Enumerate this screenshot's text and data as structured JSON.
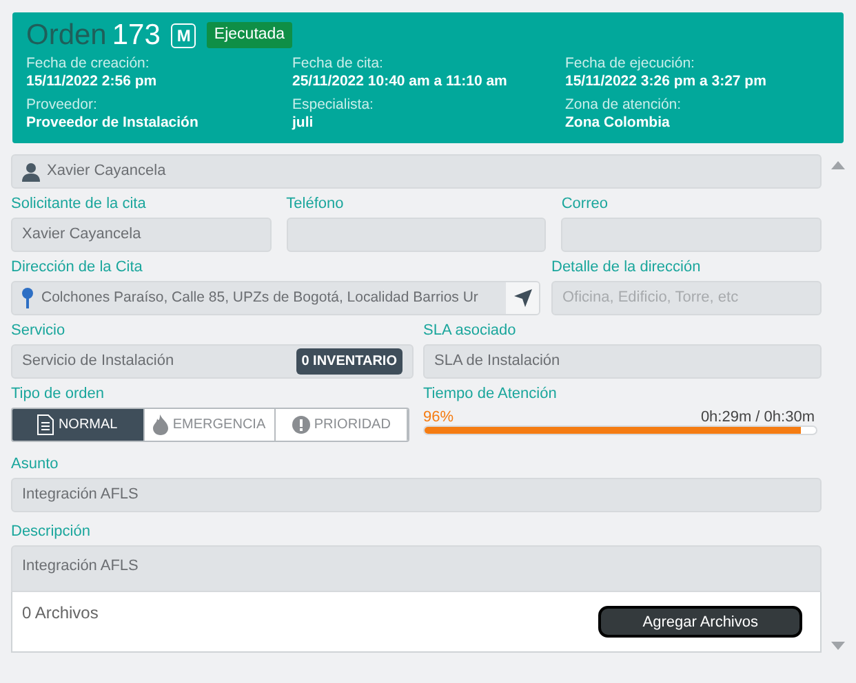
{
  "header": {
    "title": "Orden",
    "number": "173",
    "mode_badge": "M",
    "status": "Ejecutada",
    "fields": [
      {
        "label": "Fecha de creación:",
        "value": "15/11/2022 2:56 pm"
      },
      {
        "label": "Fecha de cita:",
        "value": "25/11/2022 10:40 am a 11:10 am"
      },
      {
        "label": "Fecha de ejecución:",
        "value": "15/11/2022 3:26 pm a 3:27 pm"
      },
      {
        "label": "Proveedor:",
        "value": "Proveedor de Instalación"
      },
      {
        "label": "Especialista:",
        "value": "juli"
      },
      {
        "label": "Zona de atención:",
        "value": "Zona Colombia"
      }
    ]
  },
  "client": {
    "value": "Xavier Cayancela"
  },
  "contact": [
    {
      "label": "Solicitante de la cita",
      "value": "Xavier Cayancela"
    },
    {
      "label": "Teléfono"
    },
    {
      "label": "Correo"
    }
  ],
  "address": {
    "label": "Dirección de la Cita",
    "value": "Colchones Paraíso, Calle 85, UPZs de Bogotá, Localidad Barrios Ur"
  },
  "address_detail": {
    "label": "Detalle de la dirección",
    "placeholder": "Oficina, Edificio, Torre, etc"
  },
  "service": {
    "label": "Servicio",
    "value": "Servicio de Instalación",
    "badge": "0 INVENTARIO"
  },
  "sla": {
    "label": "SLA asociado",
    "value": "SLA de Instalación"
  },
  "order_type": {
    "label": "Tipo de orden",
    "options": [
      {
        "label": "NORMAL",
        "kind": "document",
        "selected": true
      },
      {
        "label": "EMERGENCIA",
        "kind": "fire",
        "selected": false
      },
      {
        "label": "PRIORIDAD",
        "kind": "alert",
        "selected": false
      }
    ]
  },
  "attention_time": {
    "label": "Tiempo de Atención",
    "percent": "96%",
    "reading": "0h:29m / 0h:30m",
    "level": 0.96
  },
  "subject": {
    "label": "Asunto",
    "value": "Integración AFLS"
  },
  "description": {
    "label": "Descripción",
    "value": "Integración AFLS",
    "files": "0 Archivos",
    "button": "Agregar Archivos"
  }
}
